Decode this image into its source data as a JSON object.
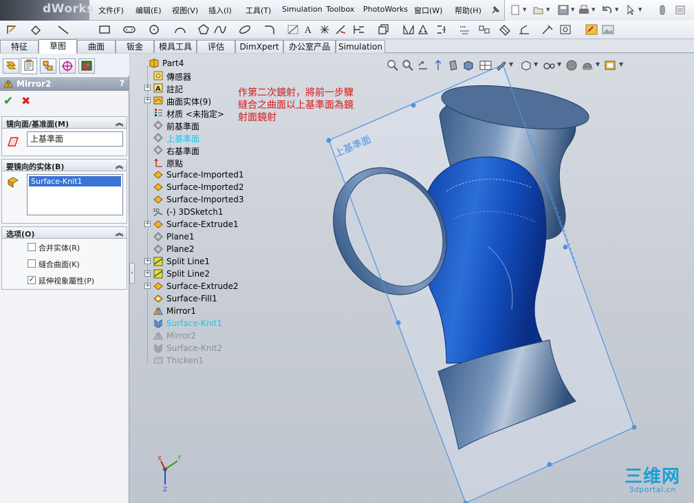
{
  "app": {
    "logo_text": "dWorks"
  },
  "menu": [
    {
      "label": "文件(F)",
      "name": "menu-file"
    },
    {
      "label": "编辑(E)",
      "name": "menu-edit"
    },
    {
      "label": "视图(V)",
      "name": "menu-view"
    },
    {
      "label": "插入(I)",
      "name": "menu-insert"
    },
    {
      "label": "工具(T)",
      "name": "menu-tools"
    },
    {
      "label": "Simulation",
      "name": "menu-simulation"
    },
    {
      "label": "Toolbox",
      "name": "menu-toolbox"
    },
    {
      "label": "PhotoWorks",
      "name": "menu-photoworks"
    },
    {
      "label": "窗口(W)",
      "name": "menu-window"
    },
    {
      "label": "帮助(H)",
      "name": "menu-help"
    }
  ],
  "command_tabs": [
    {
      "label": "特征"
    },
    {
      "label": "草图",
      "active": true
    },
    {
      "label": "曲面"
    },
    {
      "label": "钣金"
    },
    {
      "label": "模具工具"
    },
    {
      "label": "评估"
    },
    {
      "label": "DimXpert"
    },
    {
      "label": "办公室产品"
    },
    {
      "label": "Simulation"
    }
  ],
  "property_manager": {
    "title": "Mirror2",
    "help": "?",
    "ok_symbol": "✔",
    "cancel_symbol": "✖",
    "mirror_plane": {
      "header": "镜向面/基准面(M)",
      "value": "上基準面"
    },
    "bodies": {
      "header": "要镜向的实体(B)",
      "selected": "Surface-Knit1"
    },
    "options": {
      "header": "选项(O)",
      "items": [
        {
          "label": "合并实体(R)",
          "checked": false,
          "check": ""
        },
        {
          "label": "縫合曲面(K)",
          "checked": false,
          "check": ""
        },
        {
          "label": "延伸视象屬性(P)",
          "checked": true,
          "check": "✓"
        }
      ]
    }
  },
  "feature_tree": [
    {
      "label": "Part4",
      "icon": "part-icon",
      "expander": false,
      "state": "root"
    },
    {
      "label": "傳感器",
      "icon": "sensor-icon",
      "expander": false,
      "state": "normal"
    },
    {
      "label": "註記",
      "icon": "annotation-icon",
      "expander": true,
      "state": "normal"
    },
    {
      "label": "曲面实体(9)",
      "icon": "surface-bodies-icon",
      "expander": true,
      "state": "normal"
    },
    {
      "label": "材质 <未指定>",
      "icon": "material-icon",
      "expander": false,
      "state": "normal"
    },
    {
      "label": "前基準面",
      "icon": "plane-icon",
      "expander": false,
      "state": "normal"
    },
    {
      "label": "上基準面",
      "icon": "plane-icon",
      "expander": false,
      "state": "highlight"
    },
    {
      "label": "右基準面",
      "icon": "plane-icon",
      "expander": false,
      "state": "normal"
    },
    {
      "label": "原點",
      "icon": "origin-icon",
      "expander": false,
      "state": "normal"
    },
    {
      "label": "Surface-Imported1",
      "icon": "surface-icon",
      "expander": false,
      "state": "normal"
    },
    {
      "label": "Surface-Imported2",
      "icon": "surface-icon",
      "expander": false,
      "state": "normal"
    },
    {
      "label": "Surface-Imported3",
      "icon": "surface-icon",
      "expander": false,
      "state": "normal"
    },
    {
      "label": "(-) 3DSketch1",
      "icon": "sketch3d-icon",
      "expander": false,
      "state": "normal"
    },
    {
      "label": "Surface-Extrude1",
      "icon": "surface-icon",
      "expander": true,
      "state": "normal"
    },
    {
      "label": "Plane1",
      "icon": "plane-icon",
      "expander": false,
      "state": "normal"
    },
    {
      "label": "Plane2",
      "icon": "plane-icon",
      "expander": false,
      "state": "normal"
    },
    {
      "label": "Split Line1",
      "icon": "splitline-icon",
      "expander": true,
      "state": "normal"
    },
    {
      "label": "Split Line2",
      "icon": "splitline-icon",
      "expander": true,
      "state": "normal"
    },
    {
      "label": "Surface-Extrude2",
      "icon": "surface-icon",
      "expander": true,
      "state": "normal"
    },
    {
      "label": "Surface-Fill1",
      "icon": "fill-icon",
      "expander": false,
      "state": "normal"
    },
    {
      "label": "Mirror1",
      "icon": "mirror-icon",
      "expander": false,
      "state": "normal"
    },
    {
      "label": "Surface-Knit1",
      "icon": "knit-icon",
      "expander": false,
      "state": "highlight"
    },
    {
      "label": "Mirror2",
      "icon": "mirror-icon",
      "expander": false,
      "state": "suppressed"
    },
    {
      "label": "Surface-Knit2",
      "icon": "knit-icon",
      "expander": false,
      "state": "suppressed"
    },
    {
      "label": "Thicken1",
      "icon": "thicken-icon",
      "expander": false,
      "state": "suppressed"
    }
  ],
  "annotation": {
    "lines": [
      "作第二次鏡射，將前一步驟",
      "縫合之曲面以上基準面為鏡",
      "射面鏡射"
    ],
    "color": "#d71919"
  },
  "plane_label": "上基準面",
  "triad": {
    "x": "X",
    "y": "Y",
    "z": "Z"
  },
  "watermark": {
    "brand": "三维网",
    "domain": "3dportal.cn"
  },
  "colors": {
    "highlight": "#18c8e8",
    "suppressed": "#8a8f98",
    "model": "#2464c8",
    "selection": "#3a74d6"
  }
}
